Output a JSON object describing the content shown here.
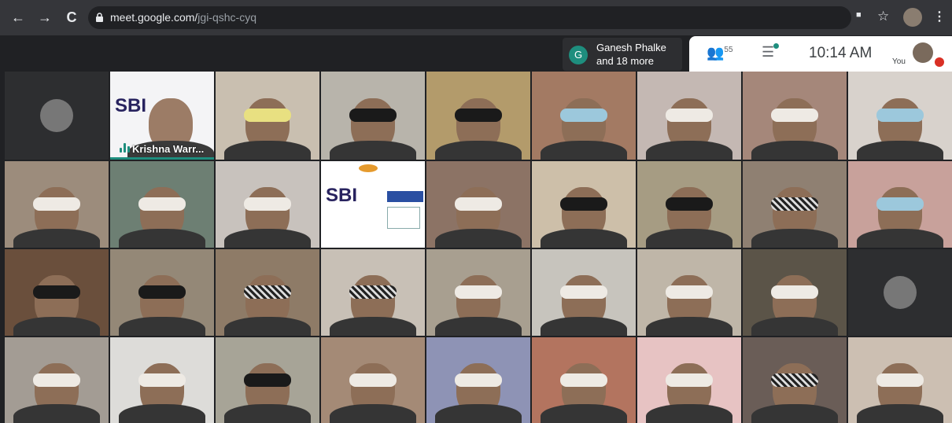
{
  "browser": {
    "url_host": "meet.google.com/",
    "url_path": "jgi-qshc-cyq",
    "back_glyph": "←",
    "forward_glyph": "→",
    "reload_glyph": "C",
    "camera_glyph": "■",
    "star_glyph": "☆",
    "menu_glyph": "⋮"
  },
  "meet": {
    "presenter_initial": "G",
    "presenter_line1": "Ganesh Phalke",
    "presenter_line2": "and 18 more",
    "people_glyph": "👥",
    "people_count": "55",
    "chat_glyph": "☰",
    "clock": "10:14 AM",
    "you_label": "You"
  },
  "tiles": [
    {
      "type": "avatar",
      "bg": "#2d2e30"
    },
    {
      "type": "speaker",
      "name": "Krishna Warr..."
    },
    {
      "type": "person",
      "bg": "#c9bfb0",
      "fold": "yellow"
    },
    {
      "type": "person",
      "bg": "#b8b4ab",
      "fold": "black"
    },
    {
      "type": "person",
      "bg": "#b39b6b",
      "fold": "black"
    },
    {
      "type": "person",
      "bg": "#a37a63",
      "fold": "blue"
    },
    {
      "type": "person",
      "bg": "#c4b8b3",
      "fold": "white"
    },
    {
      "type": "person",
      "bg": "#a5877a",
      "fold": "white"
    },
    {
      "type": "person",
      "bg": "#d8d2cc",
      "fold": "blue"
    },
    {
      "type": "person",
      "bg": "#9c8c7c",
      "fold": "white"
    },
    {
      "type": "person",
      "bg": "#6d7f73",
      "fold": "white"
    },
    {
      "type": "person",
      "bg": "#c8c2bd",
      "fold": "white"
    },
    {
      "type": "slide"
    },
    {
      "type": "person",
      "bg": "#8c7365",
      "fold": "white"
    },
    {
      "type": "person",
      "bg": "#cdbfa9",
      "fold": "black"
    },
    {
      "type": "person",
      "bg": "#a69c83",
      "fold": "black"
    },
    {
      "type": "person",
      "bg": "#8f8072",
      "fold": "check"
    },
    {
      "type": "person",
      "bg": "#c8a19b",
      "fold": "blue"
    },
    {
      "type": "person",
      "bg": "#6a4f3c",
      "fold": "black"
    },
    {
      "type": "person",
      "bg": "#948877",
      "fold": "black"
    },
    {
      "type": "person",
      "bg": "#8e7b67",
      "fold": "check"
    },
    {
      "type": "person",
      "bg": "#c8c0b6",
      "fold": "check"
    },
    {
      "type": "person",
      "bg": "#a89f90",
      "fold": "white"
    },
    {
      "type": "person",
      "bg": "#c7c4bd",
      "fold": "white"
    },
    {
      "type": "person",
      "bg": "#bfb6a8",
      "fold": "white"
    },
    {
      "type": "person",
      "bg": "#5b5448",
      "fold": "white"
    },
    {
      "type": "avatar",
      "bg": "#2d2e30"
    },
    {
      "type": "person",
      "bg": "#a39c94",
      "fold": "white"
    },
    {
      "type": "person",
      "bg": "#dddcd9",
      "fold": "white"
    },
    {
      "type": "person",
      "bg": "#a7a497",
      "fold": "black"
    },
    {
      "type": "person",
      "bg": "#a48a76",
      "fold": "white"
    },
    {
      "type": "person",
      "bg": "#8e93b5",
      "fold": "white"
    },
    {
      "type": "person",
      "bg": "#b3745f",
      "fold": "white"
    },
    {
      "type": "person",
      "bg": "#e7c3c3",
      "fold": "white"
    },
    {
      "type": "person",
      "bg": "#6a5d57",
      "fold": "check"
    },
    {
      "type": "person",
      "bg": "#ccbfb2",
      "fold": "white"
    }
  ]
}
